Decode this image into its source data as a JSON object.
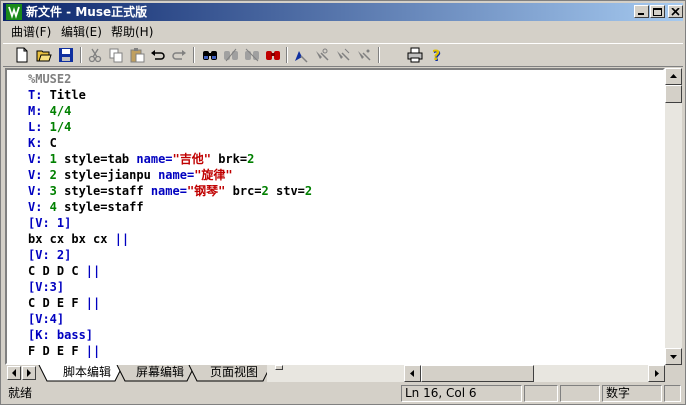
{
  "window": {
    "title": "新文件 - Muse正式版"
  },
  "menu": [
    "曲谱(F)",
    "编辑(E)",
    "帮助(H)"
  ],
  "toolbar": [
    "new-icon",
    "open-icon",
    "save-icon",
    "cut-icon",
    "copy-icon",
    "paste-icon",
    "undo-icon",
    "redo-icon",
    "find-icon",
    "find-next-icon",
    "replace-icon",
    "find-red-icon",
    "pen-icon",
    "tool1-icon",
    "tool2-icon",
    "tool3-icon",
    "print-icon",
    "help-icon"
  ],
  "editor_lines": [
    [
      [
        "cmt",
        "%MUSE2"
      ]
    ],
    [
      [
        "kw",
        "T:"
      ],
      [
        "txt",
        " Title"
      ]
    ],
    [
      [
        "kw",
        "M:"
      ],
      [
        "num",
        " 4/4"
      ]
    ],
    [
      [
        "kw",
        "L:"
      ],
      [
        "num",
        " 1/4"
      ]
    ],
    [
      [
        "kw",
        "K:"
      ],
      [
        "txt",
        " C"
      ]
    ],
    [
      [
        "kw",
        "V:"
      ],
      [
        "num",
        " 1"
      ],
      [
        "txt",
        " style=tab "
      ],
      [
        "kw",
        "name="
      ],
      [
        "str",
        "\"吉他\""
      ],
      [
        "txt",
        " brk="
      ],
      [
        "num",
        "2"
      ]
    ],
    [
      [
        "kw",
        "V:"
      ],
      [
        "num",
        " 2"
      ],
      [
        "txt",
        " style=jianpu "
      ],
      [
        "kw",
        "name="
      ],
      [
        "str",
        "\"旋律\""
      ]
    ],
    [
      [
        "kw",
        "V:"
      ],
      [
        "num",
        " 3"
      ],
      [
        "txt",
        " style=staff "
      ],
      [
        "kw",
        "name="
      ],
      [
        "str",
        "\"钢琴\""
      ],
      [
        "txt",
        " brc="
      ],
      [
        "num",
        "2"
      ],
      [
        "txt",
        " stv="
      ],
      [
        "num",
        "2"
      ]
    ],
    [
      [
        "kw",
        "V:"
      ],
      [
        "num",
        " 4"
      ],
      [
        "txt",
        " style=staff"
      ]
    ],
    [
      [
        "kw",
        "[V: 1]"
      ]
    ],
    [
      [
        "txt",
        "bx cx bx cx "
      ],
      [
        "bar",
        "||"
      ]
    ],
    [
      [
        "kw",
        "[V: 2]"
      ]
    ],
    [
      [
        "txt",
        "C D D C "
      ],
      [
        "bar",
        "||"
      ]
    ],
    [
      [
        "kw",
        "[V:3]"
      ]
    ],
    [
      [
        "txt",
        "C D E F "
      ],
      [
        "bar",
        "||"
      ]
    ],
    [
      [
        "kw",
        "[V:4]"
      ]
    ],
    [
      [
        "kw",
        "[K: bass]"
      ]
    ],
    [
      [
        "txt",
        "F D E F "
      ],
      [
        "bar",
        "||"
      ]
    ]
  ],
  "tabs": [
    "脚本编辑",
    "屏幕编辑",
    "页面视图"
  ],
  "status": {
    "ready": "就绪",
    "position": "Ln 16, Col 6",
    "mode": "数字"
  }
}
